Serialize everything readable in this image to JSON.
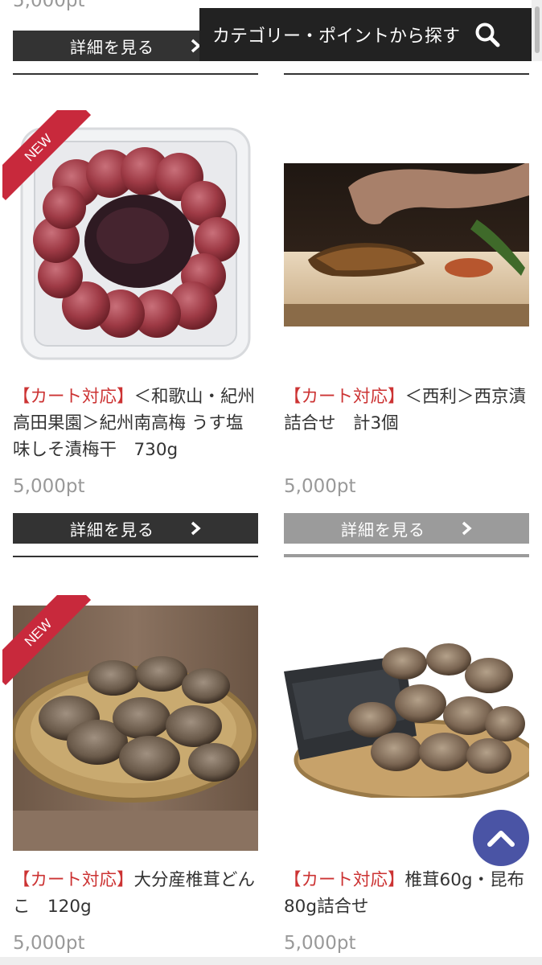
{
  "header": {
    "search_label": "カテゴリー・ポイントから探す",
    "search_icon": "search-icon"
  },
  "partial_top": {
    "points": "5,000pt",
    "detail_label": "詳細を見る"
  },
  "products": [
    {
      "tag": "【カート対応】",
      "name": "＜和歌山・紀州高田果園＞紀州南高梅 うす塩味しそ漬梅干　730g",
      "points": "5,000pt",
      "detail_label": "詳細を見る",
      "badge": "NEW",
      "image": "umeboshi-photo"
    },
    {
      "tag": "【カート対応】",
      "name": "＜西利＞西京漬詰合せ　計3個",
      "points": "5,000pt",
      "detail_label": "詳細を見る",
      "badge": "",
      "image": "saikyo-fish-photo"
    },
    {
      "tag": "【カート対応】",
      "name": "大分産椎茸どんこ　120g",
      "points": "5,000pt",
      "badge": "NEW",
      "image": "shiitake-photo"
    },
    {
      "tag": "【カート対応】",
      "name": "椎茸60g・昆布80g詰合せ",
      "points": "5,000pt",
      "badge": "",
      "image": "shiitake-kombu-photo"
    }
  ],
  "scroll_top_icon": "chevron-up-icon"
}
